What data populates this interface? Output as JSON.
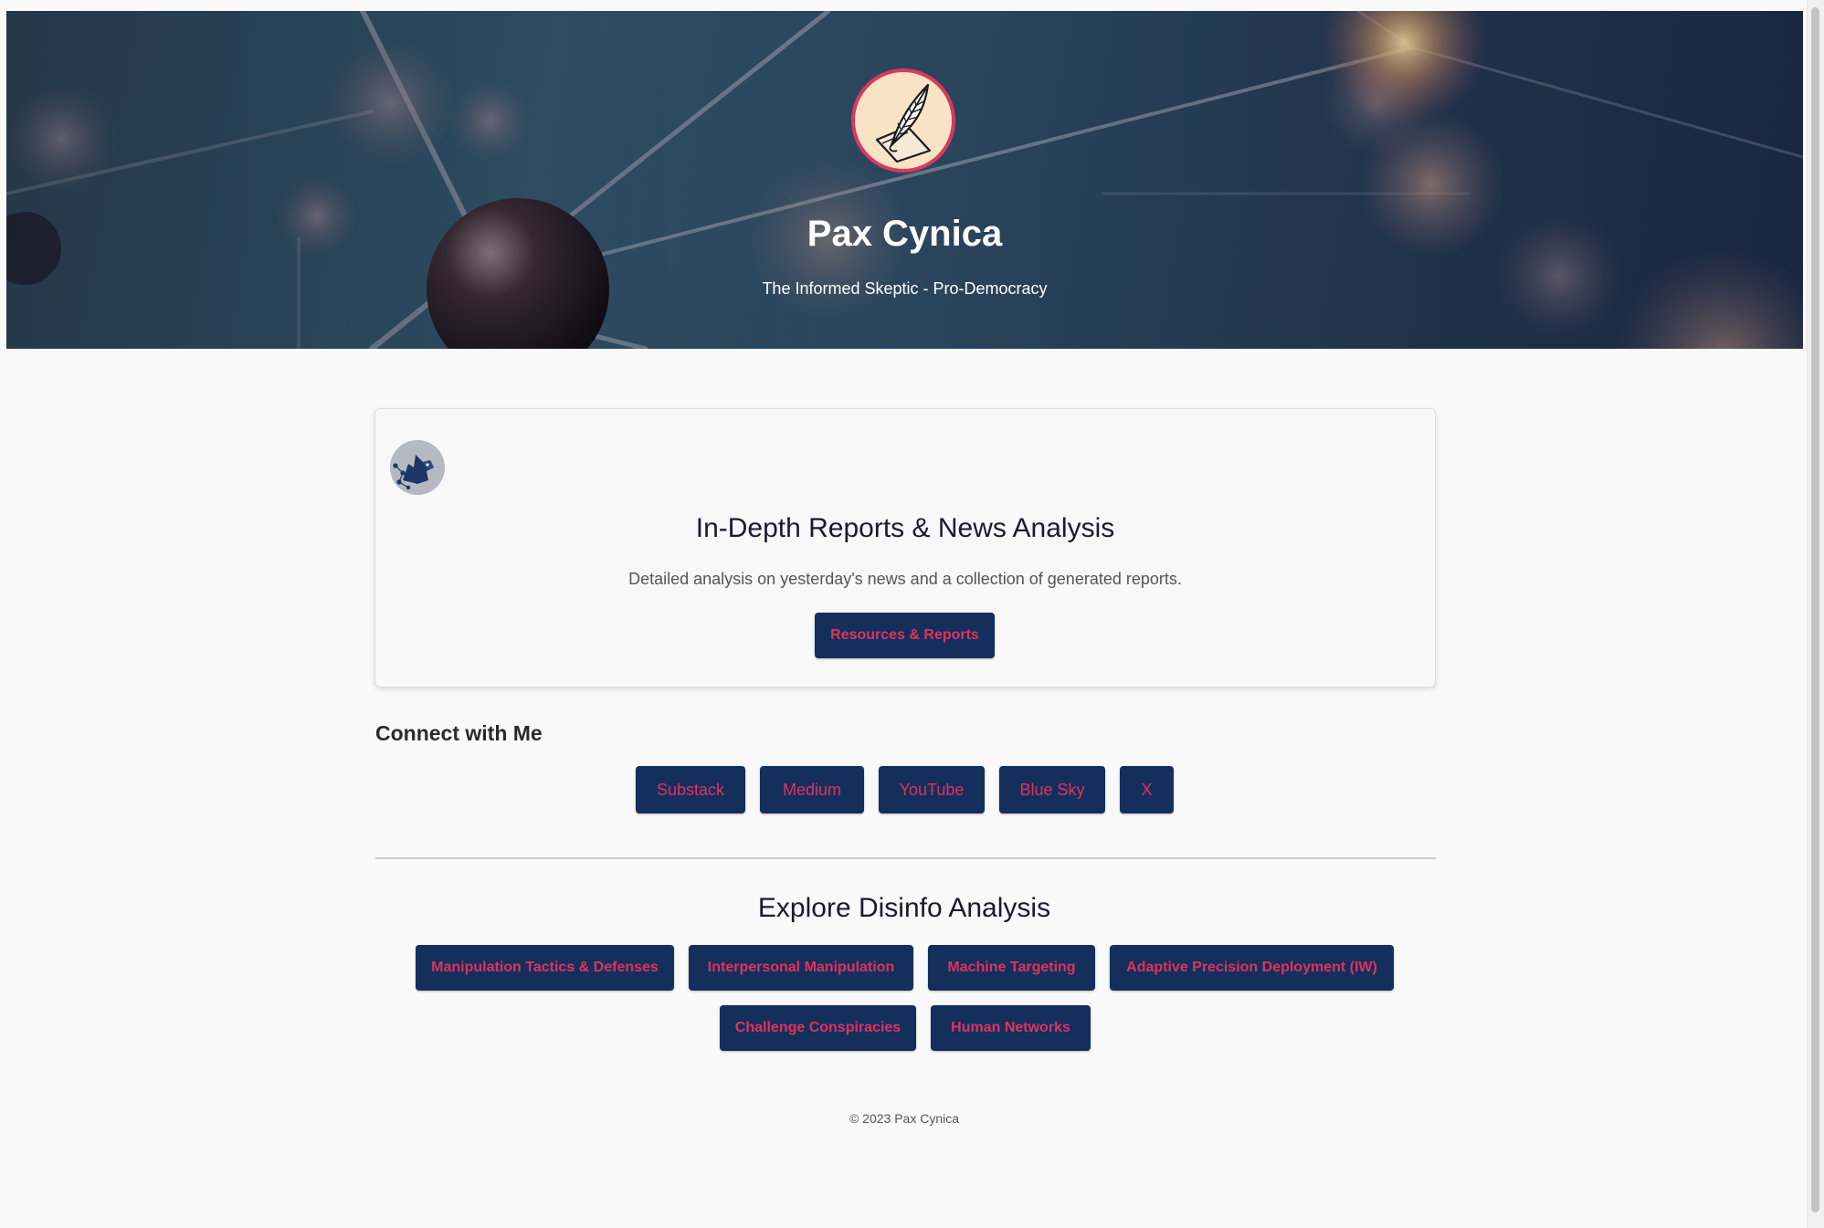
{
  "hero": {
    "title": "Pax Cynica",
    "tagline": "The Informed Skeptic - Pro-Democracy",
    "logo_icon": "quill-on-paper-icon"
  },
  "card": {
    "avatar_icon": "wolf-network-icon",
    "title": "In-Depth Reports & News Analysis",
    "description": "Detailed analysis on yesterday's news and a collection of generated reports.",
    "button_label": "Resources & Reports"
  },
  "connect": {
    "heading": "Connect with Me",
    "links": [
      {
        "label": "Substack"
      },
      {
        "label": "Medium"
      },
      {
        "label": "YouTube"
      },
      {
        "label": "Blue Sky"
      },
      {
        "label": "X"
      }
    ]
  },
  "explore": {
    "heading": "Explore Disinfo Analysis",
    "links": [
      {
        "label": "Manipulation Tactics & Defenses"
      },
      {
        "label": "Interpersonal Manipulation"
      },
      {
        "label": "Machine Targeting"
      },
      {
        "label": "Adaptive Precision Deployment (IW)"
      },
      {
        "label": "Challenge Conspiracies"
      },
      {
        "label": "Human Networks"
      }
    ]
  },
  "footer": {
    "text": "© 2023 Pax Cynica"
  },
  "colors": {
    "button_bg": "#142f5c",
    "button_text": "#e0325e",
    "logo_border": "#d9395e",
    "page_bg": "#f9f9f9"
  }
}
